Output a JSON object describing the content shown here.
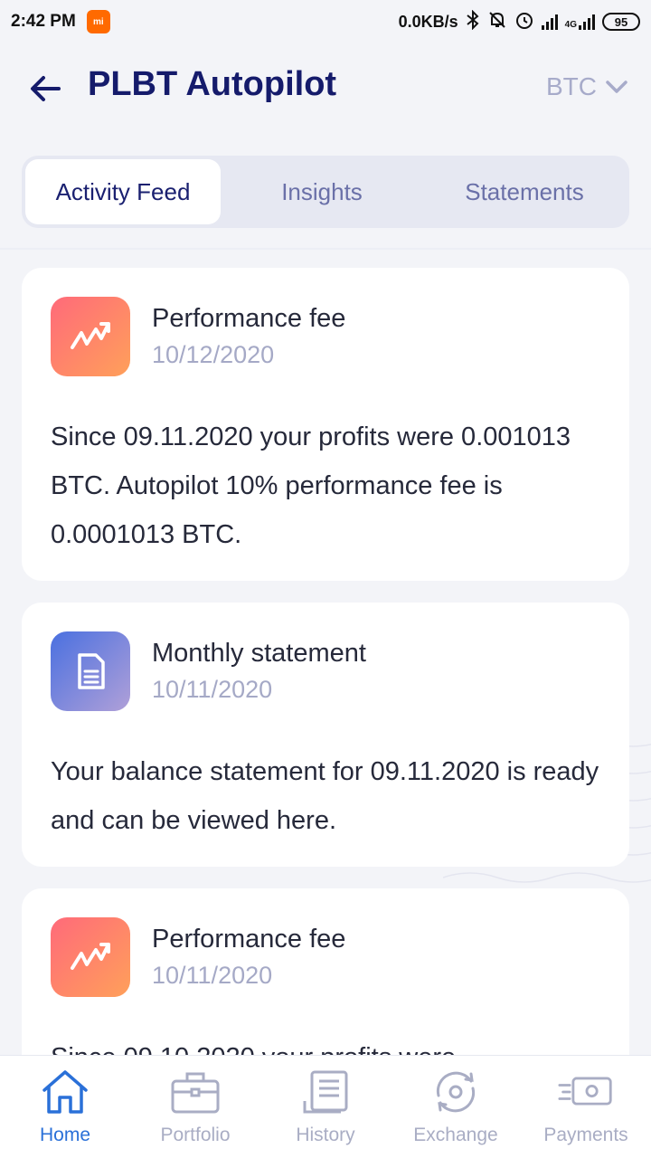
{
  "status_bar": {
    "time": "2:42 PM",
    "net_speed": "0.0KB/s",
    "network_type": "4G",
    "battery": "95"
  },
  "header": {
    "title": "PLBT Autopilot",
    "currency": "BTC"
  },
  "tabs": [
    {
      "label": "Activity Feed",
      "active": true
    },
    {
      "label": "Insights",
      "active": false
    },
    {
      "label": "Statements",
      "active": false
    }
  ],
  "feed": [
    {
      "icon": "trend-up-icon",
      "title": "Performance fee",
      "date": "10/12/2020",
      "body": "Since 09.11.2020 your profits were 0.001013 BTC. Autopilot 10% performance fee is 0.0001013 BTC."
    },
    {
      "icon": "document-icon",
      "title": "Monthly statement",
      "date": "10/11/2020",
      "body": "Your balance statement for 09.11.2020 is ready and can be viewed here."
    },
    {
      "icon": "trend-up-icon",
      "title": "Performance fee",
      "date": "10/11/2020",
      "body": "Since 09.10.2020 your profits were"
    }
  ],
  "bottom_nav": [
    {
      "label": "Home",
      "icon": "home-icon",
      "active": true
    },
    {
      "label": "Portfolio",
      "icon": "briefcase-icon",
      "active": false
    },
    {
      "label": "History",
      "icon": "history-icon",
      "active": false
    },
    {
      "label": "Exchange",
      "icon": "exchange-icon",
      "active": false
    },
    {
      "label": "Payments",
      "icon": "payments-icon",
      "active": false
    }
  ],
  "colors": {
    "title": "#151b6b",
    "active_nav": "#2a70d8",
    "muted": "#a7abca"
  }
}
